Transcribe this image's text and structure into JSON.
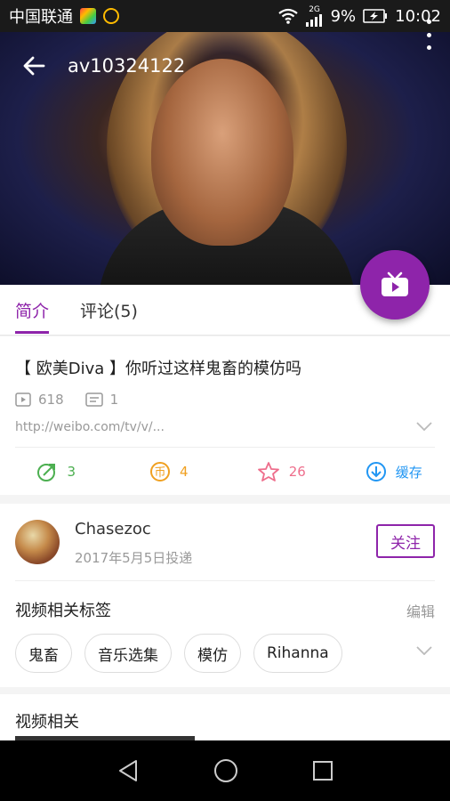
{
  "status_bar": {
    "carrier": "中国联通",
    "network": "2G",
    "battery": "9%",
    "time": "10:02"
  },
  "header": {
    "title": "av10324122"
  },
  "tabs": [
    {
      "label": "简介",
      "active": true
    },
    {
      "label": "评论(5)",
      "active": false
    }
  ],
  "video": {
    "title": "【 欧美Diva 】你听过这样鬼畜的模仿吗",
    "plays": "618",
    "danmaku": "1",
    "url": "http://weibo.com/tv/v/...",
    "actions": [
      {
        "icon": "share-icon",
        "label": "3",
        "color": "#4caf50"
      },
      {
        "icon": "coin-icon",
        "label": "4",
        "color": "#f0a020"
      },
      {
        "icon": "star-icon",
        "label": "26",
        "color": "#ee6e8c"
      },
      {
        "icon": "download-icon",
        "label": "缓存",
        "color": "#2196f3"
      }
    ]
  },
  "uploader": {
    "name": "Chasezoc",
    "date": "2017年5月5日投递",
    "follow_label": "关注"
  },
  "tags_section": {
    "heading": "视频相关标签",
    "edit_label": "编辑",
    "tags": [
      "鬼畜",
      "音乐选集",
      "模仿",
      "Rihanna"
    ]
  },
  "related": {
    "heading": "视频相关"
  },
  "colors": {
    "accent": "#8e24aa"
  }
}
